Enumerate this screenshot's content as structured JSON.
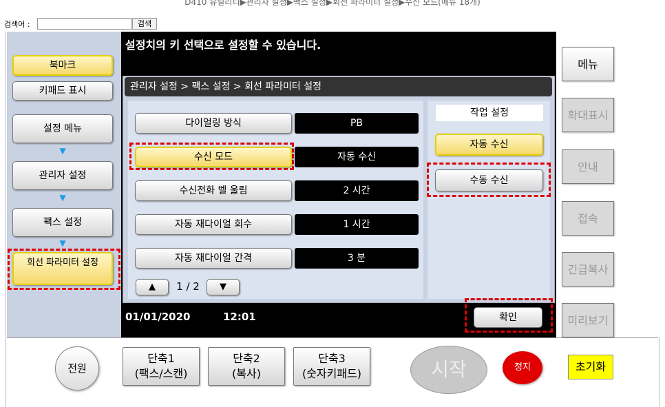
{
  "window": {
    "title": "D410 유틸리티▶관리자 설정▶팩스 설정▶회선 파라미터 설정▶수신 모드(메뉴 18개)"
  },
  "search": {
    "label": "검색어 :",
    "value": "",
    "button": "검색"
  },
  "left": {
    "bookmark": "북마크",
    "keypad": "키패드 표시",
    "items": [
      "설정 메뉴",
      "관리자 설정",
      "팩스 설정",
      "회선 파라미터 설정"
    ]
  },
  "screen": {
    "message": "설정치의 키 선택으로 설정할 수 있습니다.",
    "breadcrumb": "관리자 설정 > 팩스 설정 > 회선 파라미터 설정",
    "settings": [
      {
        "label": "다이얼링 방식",
        "value": "PB"
      },
      {
        "label": "수신 모드",
        "value": "자동 수신"
      },
      {
        "label": "수신전화 벨 울림",
        "value": "2 시간"
      },
      {
        "label": "자동 재다이얼 회수",
        "value": "1 시간"
      },
      {
        "label": "자동 재다이얼 간격",
        "value": "3 분"
      }
    ],
    "pager": {
      "up": "▲",
      "page": "1 / 2",
      "down": "▼"
    },
    "side": {
      "heading": "작업 설정",
      "auto": "자동 수신",
      "manual": "수동 수신"
    },
    "date": "01/01/2020",
    "time": "12:01",
    "ok": "확인"
  },
  "right": {
    "menu": "메뉴",
    "zoom": "확대표시",
    "guide": "안내",
    "access": "접속",
    "urgent": "긴급복사",
    "preview": "미리보기"
  },
  "bottom": {
    "power": "전원",
    "shortcut1": "단축1\n(팩스/스캔)",
    "shortcut2": "단축2\n(복사)",
    "shortcut3": "단축3\n(숫자키패드)",
    "start": "시작",
    "stop": "정지",
    "reset": "초기화"
  },
  "colors": {
    "highlight": "#e00000",
    "accent_yellow": "#f5d96a",
    "arrow": "#1f9be8",
    "stop": "#e00000",
    "reset": "#ffff00"
  }
}
